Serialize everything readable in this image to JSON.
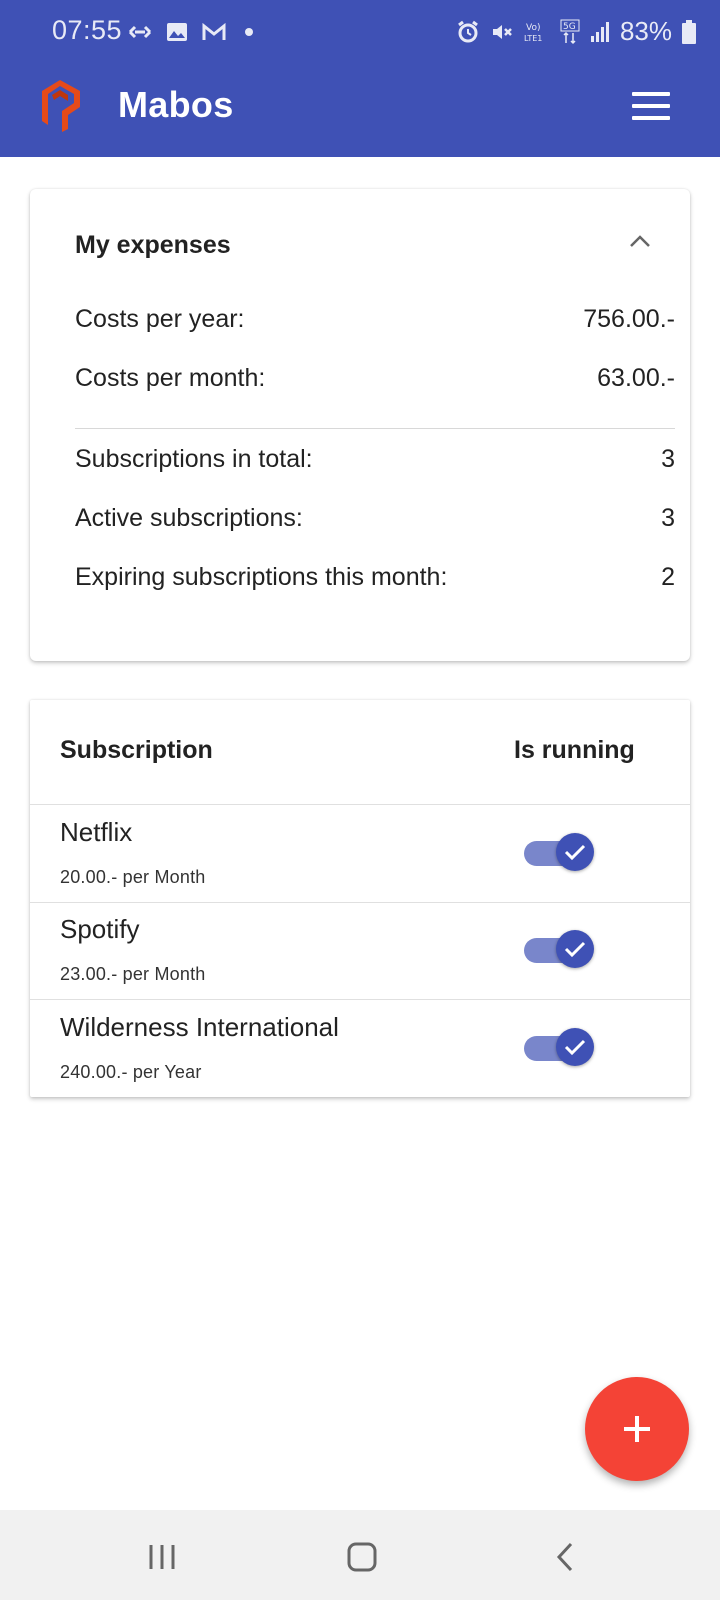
{
  "status_bar": {
    "time": "07:55",
    "battery": "83%",
    "left_icons": [
      "link-icon",
      "image-icon",
      "gmail-icon",
      "dot-icon"
    ],
    "right_icons": [
      "alarm-icon",
      "mute-icon",
      "volte-icon",
      "5g-icon",
      "signal-icon",
      "battery-icon"
    ]
  },
  "appbar": {
    "title": "Mabos",
    "logo_color": "#e64a19",
    "color": "#3f51b5"
  },
  "expenses": {
    "title": "My expenses",
    "rows": [
      {
        "label": "Costs per year:",
        "value": "756.00.-"
      },
      {
        "label": "Costs per month:",
        "value": "63.00.-"
      },
      {
        "label": "Subscriptions in total:",
        "value": "3"
      },
      {
        "label": "Active subscriptions:",
        "value": "3"
      },
      {
        "label": "Expiring subscriptions this month:",
        "value": "2"
      }
    ]
  },
  "subscriptions": {
    "columns": [
      "Subscription",
      "Is running"
    ],
    "items": [
      {
        "name": "Netflix",
        "price": "20.00.- per Month",
        "running": true
      },
      {
        "name": "Spotify",
        "price": "23.00.- per Month",
        "running": true
      },
      {
        "name": "Wilderness International",
        "price": "240.00.- per Year",
        "running": true
      }
    ]
  },
  "fab": {
    "icon": "plus-icon",
    "color": "#f44336"
  },
  "navbar": {
    "buttons": [
      "recent-apps-icon",
      "home-icon",
      "back-icon"
    ]
  }
}
